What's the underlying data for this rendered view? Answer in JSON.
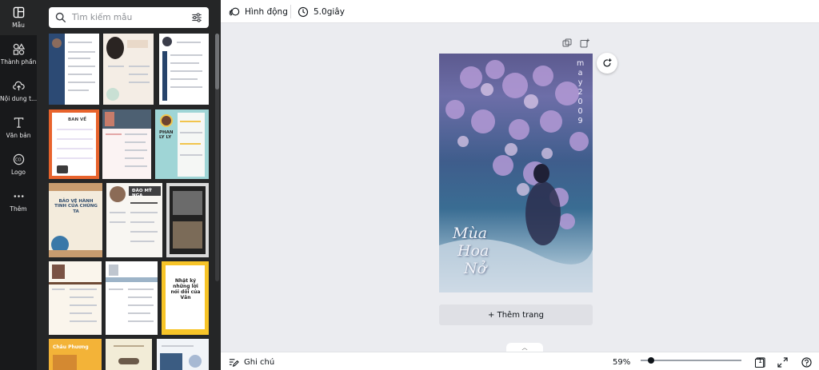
{
  "rail": [
    {
      "label": "Mẫu",
      "icon": "layout-icon",
      "active": true
    },
    {
      "label": "Thành phần",
      "icon": "shapes-icon"
    },
    {
      "label": "Nội dung t...",
      "icon": "upload-icon"
    },
    {
      "label": "Văn bản",
      "icon": "text-icon"
    },
    {
      "label": "Logo",
      "icon": "logo-icon"
    },
    {
      "label": "Thêm",
      "icon": "more-icon"
    }
  ],
  "search": {
    "placeholder": "Tìm kiếm mẫu"
  },
  "templates": {
    "t4_title": "BAN VỀ",
    "t6_name": "PHAN LY LY",
    "t7_title": "BẢO VỆ HÀNH TINH CỦA CHÚNG TA",
    "t8_name": "ĐÀO MỸ NGA",
    "t12_title": "Nhật ký những lời nói dối của Văn",
    "t13_title": "Châu Phương"
  },
  "toolbar": {
    "animate_label": "Hình động",
    "duration_label": "5.0giây"
  },
  "page": {
    "vertical_text": [
      "m",
      "a",
      "y",
      "2",
      "0",
      "0",
      "9"
    ],
    "title_lines": [
      "Mùa",
      "Hoa",
      "Nở"
    ]
  },
  "add_page_label": "+ Thêm trang",
  "bottom": {
    "notes_label": "Ghi chú",
    "zoom_label": "59%",
    "page_count": "1",
    "zoom_fraction": 0.1
  },
  "colors": {
    "rail_bg": "#18191b",
    "panel_bg": "#252627",
    "canvas_bg": "#ebecf0",
    "accent": "#0e1318"
  }
}
